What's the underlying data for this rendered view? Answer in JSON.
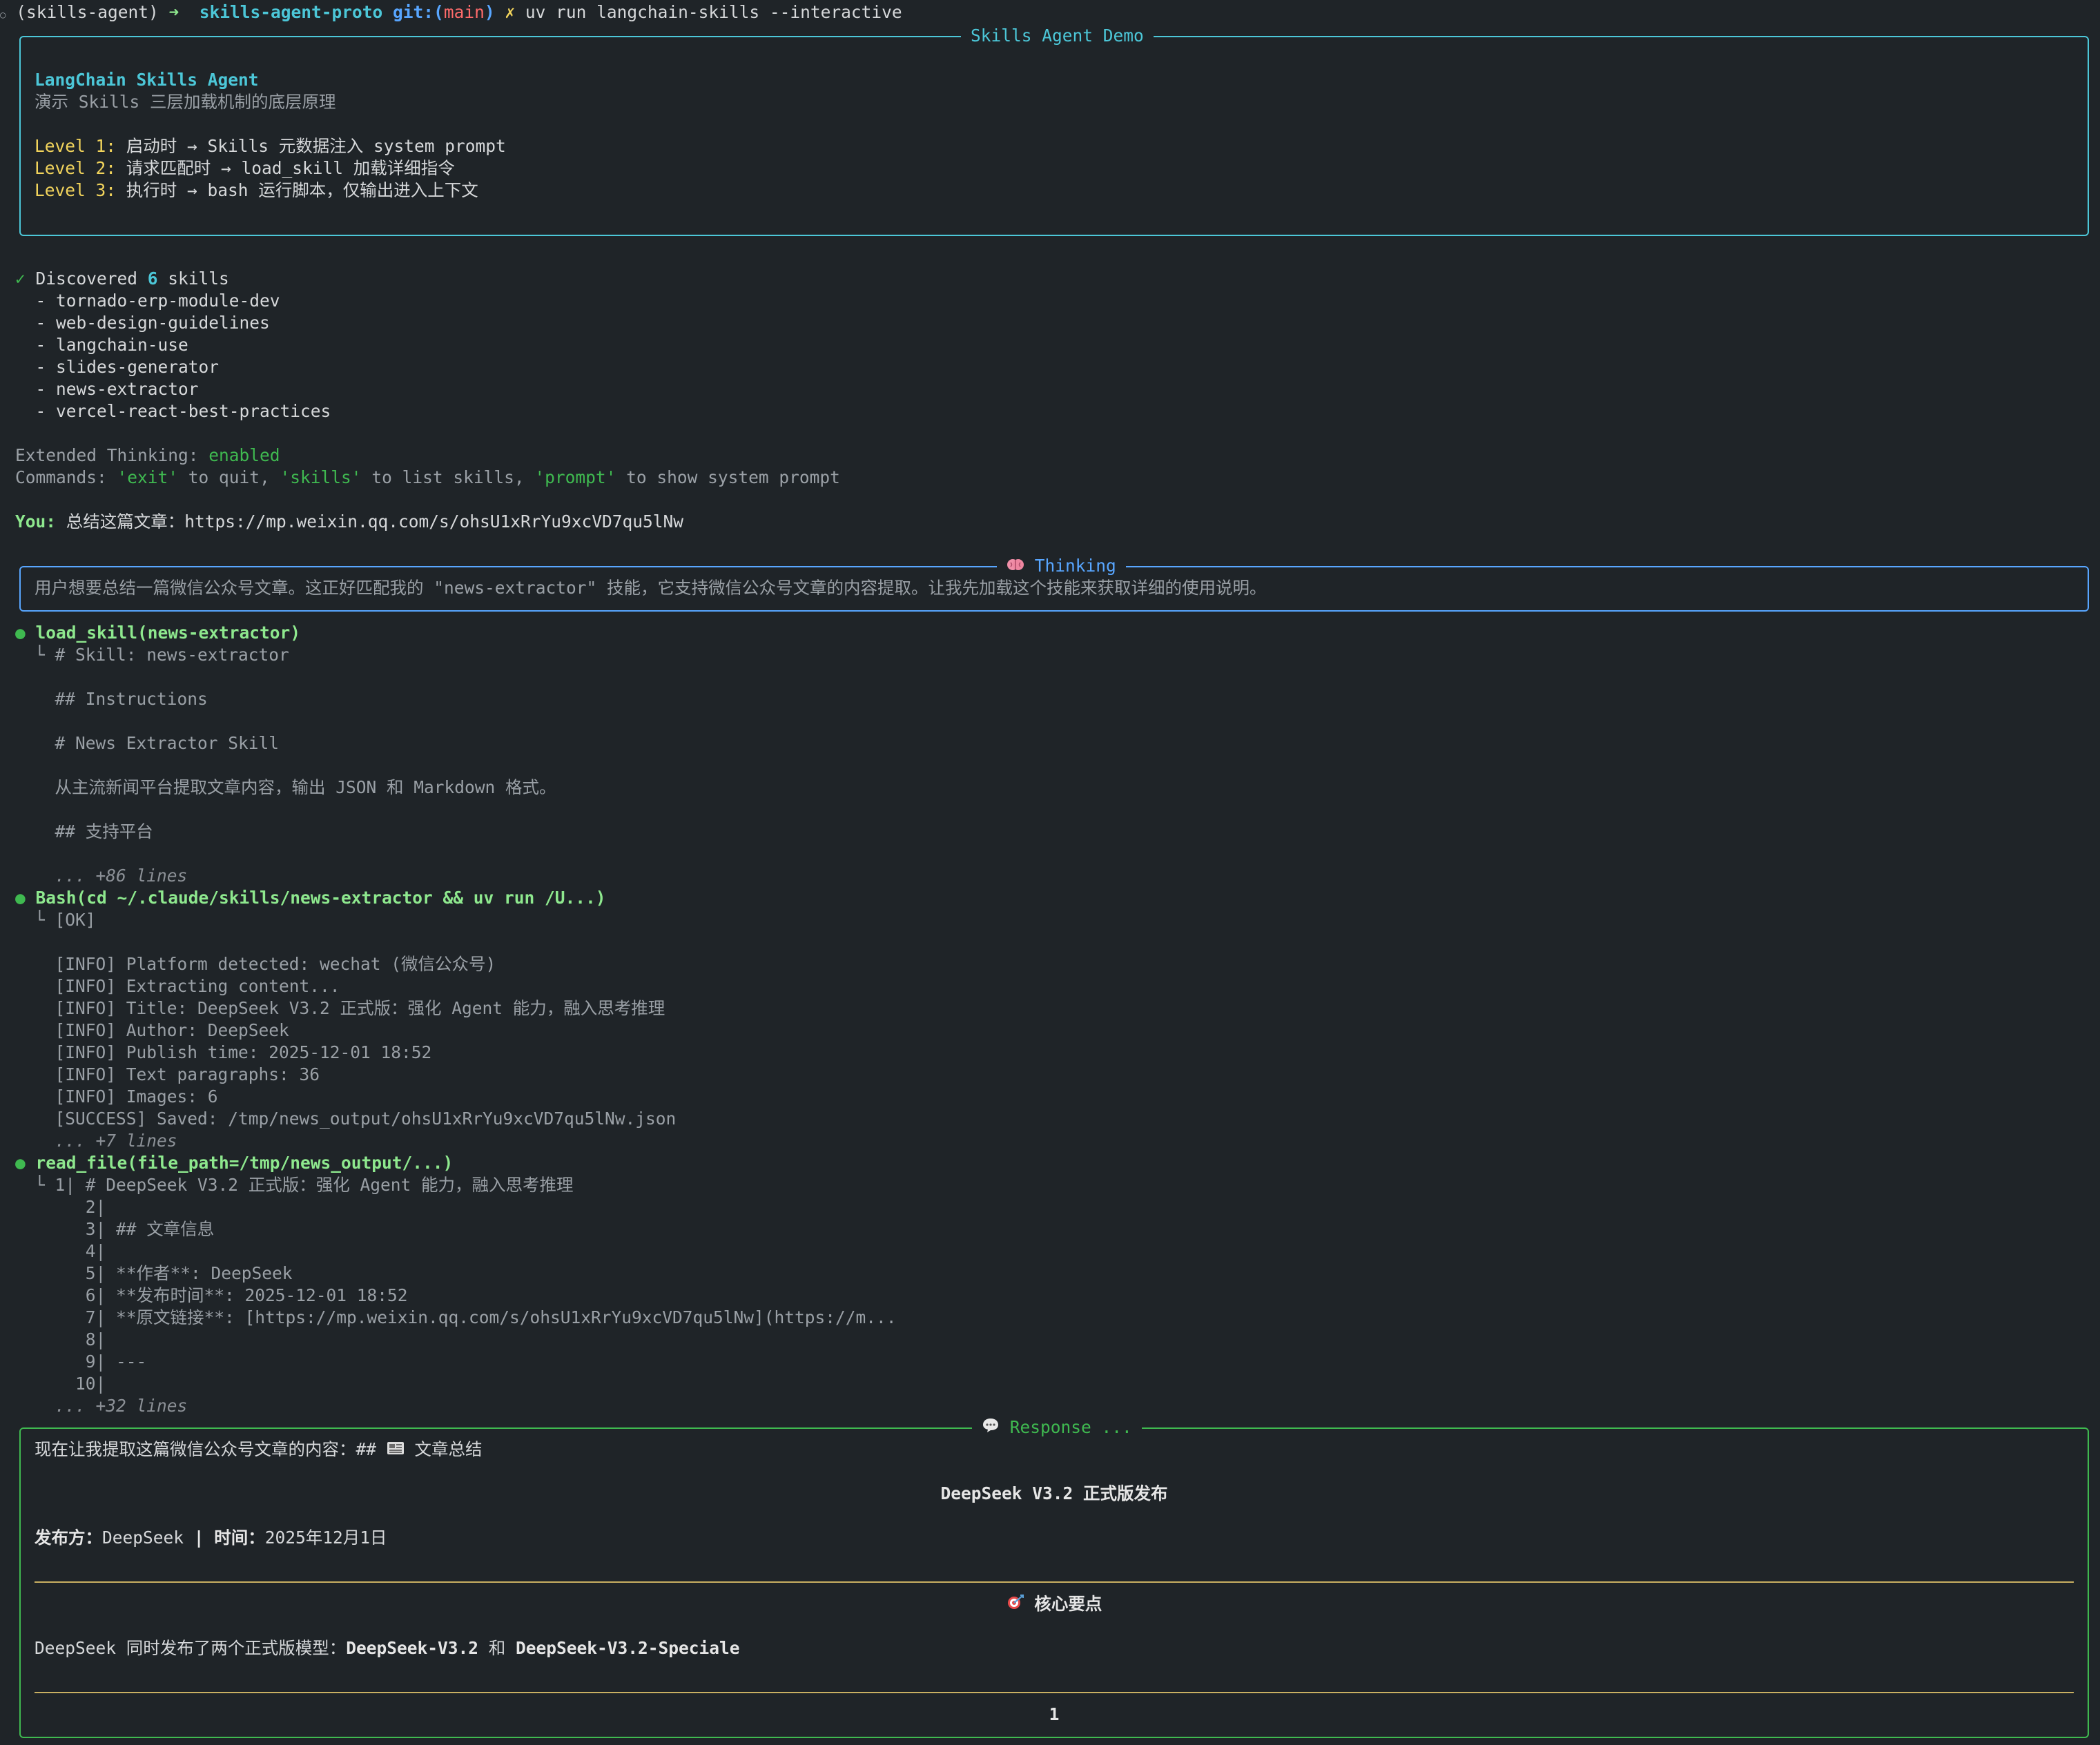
{
  "prompt": {
    "env": "(skills-agent)",
    "arrow": "➜",
    "dir": "skills-agent-proto",
    "git_label": "git:(",
    "branch": "main",
    "git_close": ")",
    "dirty": "✗",
    "command": "uv run langchain-skills --interactive"
  },
  "banner": {
    "title": "Skills Agent Demo",
    "app_name": "LangChain Skills Agent",
    "subtitle": "演示 Skills 三层加载机制的底层原理",
    "levels": [
      {
        "label": "Level 1:",
        "text": " 启动时 → Skills 元数据注入 system prompt"
      },
      {
        "label": "Level 2:",
        "text": " 请求匹配时 → load_skill 加载详细指令"
      },
      {
        "label": "Level 3:",
        "text": " 执行时 → bash 运行脚本，仅输出进入上下文"
      }
    ]
  },
  "discovered": {
    "check": "✓",
    "prefix": " Discovered ",
    "count": "6",
    "suffix": " skills",
    "skills": [
      "  - tornado-erp-module-dev",
      "  - web-design-guidelines",
      "  - langchain-use",
      "  - slides-generator",
      "  - news-extractor",
      "  - vercel-react-best-practices"
    ]
  },
  "settings": {
    "thinking_label": "Extended Thinking: ",
    "thinking_value": "enabled",
    "commands_label": "Commands: ",
    "cmd_exit": "'exit'",
    "cmd_exit_desc": " to quit, ",
    "cmd_skills": "'skills'",
    "cmd_skills_desc": " to list skills, ",
    "cmd_prompt": "'prompt'",
    "cmd_prompt_desc": " to show system prompt"
  },
  "user": {
    "label": "You:",
    "message": " 总结这篇文章：https://mp.weixin.qq.com/s/ohsU1xRrYu9xcVD7qu5lNw"
  },
  "thinking": {
    "icon": "brain-icon",
    "title": "Thinking",
    "text": "用户想要总结一篇微信公众号文章。这正好匹配我的 \"news-extractor\" 技能，它支持微信公众号文章的内容提取。让我先加载这个技能来获取详细的使用说明。"
  },
  "tool_calls": [
    {
      "name": "load_skill(news-extractor)",
      "lines": [
        "└ # Skill: news-extractor",
        "",
        "  ## Instructions",
        "",
        "  # News Extractor Skill",
        "",
        "  从主流新闻平台提取文章内容，输出 JSON 和 Markdown 格式。",
        "",
        "  ## 支持平台",
        ""
      ],
      "more": "  ... +86 lines"
    },
    {
      "name": "Bash(cd ~/.claude/skills/news-extractor && uv run /U...)",
      "lines": [
        "└ [OK]",
        "",
        "  [INFO] Platform detected: wechat (微信公众号)",
        "  [INFO] Extracting content...",
        "  [INFO] Title: DeepSeek V3.2 正式版：强化 Agent 能力，融入思考推理",
        "  [INFO] Author: DeepSeek",
        "  [INFO] Publish time: 2025-12-01 18:52",
        "  [INFO] Text paragraphs: 36",
        "  [INFO] Images: 6",
        "  [SUCCESS] Saved: /tmp/news_output/ohsU1xRrYu9xcVD7qu5lNw.json"
      ],
      "more": "  ... +7 lines"
    },
    {
      "name": "read_file(file_path=/tmp/news_output/...)",
      "lines": [
        "└ 1| # DeepSeek V3.2 正式版：强化 Agent 能力，融入思考推理",
        "     2|",
        "     3| ## 文章信息",
        "     4|",
        "     5| **作者**: DeepSeek",
        "     6| **发布时间**: 2025-12-01 18:52",
        "     7| **原文链接**: [https://mp.weixin.qq.com/s/ohsU1xRrYu9xcVD7qu5lNw](https://m...",
        "     8|",
        "     9| ---",
        "    10|"
      ],
      "more": "  ... +32 lines"
    }
  ],
  "response": {
    "icon": "chat-icon",
    "title": "Response ...",
    "intro": "现在让我提取这篇微信公众号文章的内容：## ",
    "news_icon": "newspaper-icon",
    "intro_tail": " 文章总结",
    "headline": "DeepSeek V3.2 正式版发布",
    "meta_label1": "发布方：",
    "meta_value1": "DeepSeek",
    "meta_sep": " | ",
    "meta_label2": "时间：",
    "meta_value2": "2025年12月1日",
    "section_icon": "target-icon",
    "section_title": "核心要点",
    "point_prefix": "DeepSeek 同时发布了两个正式版模型：",
    "model_1": "DeepSeek-V3.2",
    "point_and": " 和 ",
    "model_2": "DeepSeek-V3.2-Speciale",
    "list_number": "1"
  },
  "colors": {
    "background": "#1f2428",
    "cyan": "#4cc7d8",
    "green": "#3fb950",
    "yellow": "#f2d45c",
    "blue": "#58a6ff",
    "rule": "#c9b062"
  }
}
